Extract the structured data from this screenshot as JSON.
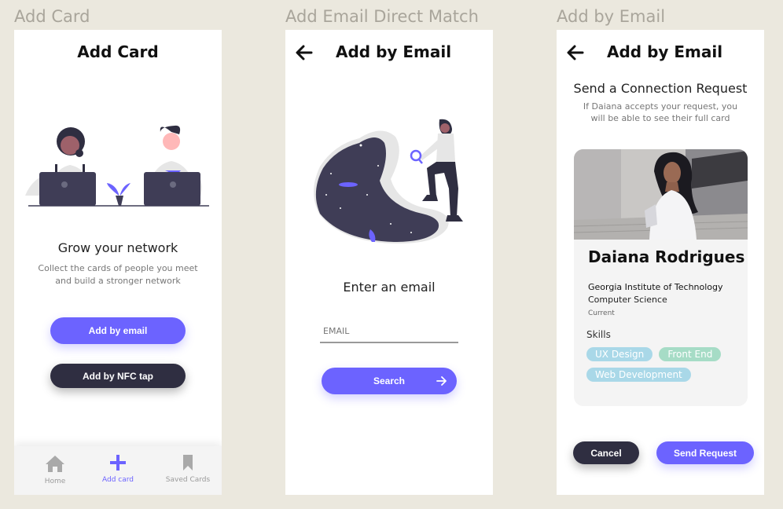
{
  "frames": [
    {
      "label": "Add Card"
    },
    {
      "label": "Add Email Direct Match"
    },
    {
      "label": "Add by Email"
    }
  ],
  "screen1": {
    "title": "Add Card",
    "heading": "Grow your network",
    "description_line1": "Collect the cards of people you meet",
    "description_line2": "and build a stronger network",
    "add_by_email_label": "Add by email",
    "add_by_nfc_label": "Add by NFC tap",
    "tabs": [
      {
        "label": "Home",
        "icon": "home-icon"
      },
      {
        "label": "Add card",
        "icon": "plus-icon"
      },
      {
        "label": "Saved Cards",
        "icon": "bookmark-icon"
      }
    ]
  },
  "screen2": {
    "title": "Add by Email",
    "heading": "Enter an email",
    "email_placeholder": "EMAIL",
    "search_label": "Search"
  },
  "screen3": {
    "title": "Add by Email",
    "heading": "Send a Connection Request",
    "description_line1": "If Daiana accepts your request, you",
    "description_line2": "will be able to see their full card",
    "card": {
      "name": "Daiana Rodrigues",
      "school": "Georgia Institute of Technology",
      "major": "Computer Science",
      "status": "Current",
      "skills_label": "Skills",
      "skills": [
        "UX Design",
        "Front End",
        "Web Development"
      ]
    },
    "cancel_label": "Cancel",
    "send_label": "Send Request"
  },
  "colors": {
    "accent": "#6c63ff",
    "dark": "#2f2e41",
    "background": "#ebe8de",
    "chip_blue": "#a9d8e8",
    "chip_green": "#a6dcc6"
  }
}
